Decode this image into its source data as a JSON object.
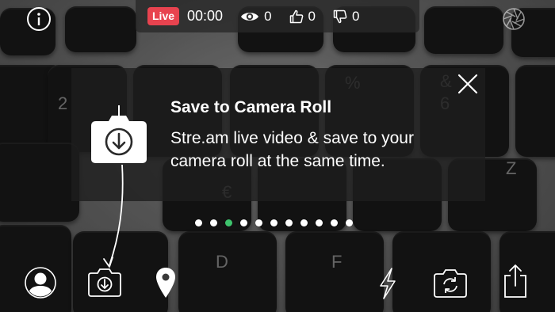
{
  "status_bar": {
    "live_label": "Live",
    "timer": "00:00",
    "views": "0",
    "likes": "0",
    "dislikes": "0"
  },
  "tooltip": {
    "title": "Save to Camera Roll",
    "body": "Stre.am live video & save to your camera roll at the same time."
  },
  "pagination": {
    "total": 11,
    "active_index": 2
  },
  "toolbar": {
    "items": [
      "profile",
      "save-to-camera-roll",
      "location",
      "flash",
      "switch-camera",
      "share"
    ]
  },
  "colors": {
    "live_badge": "#e8434f",
    "active_dot": "#3ec46d"
  }
}
